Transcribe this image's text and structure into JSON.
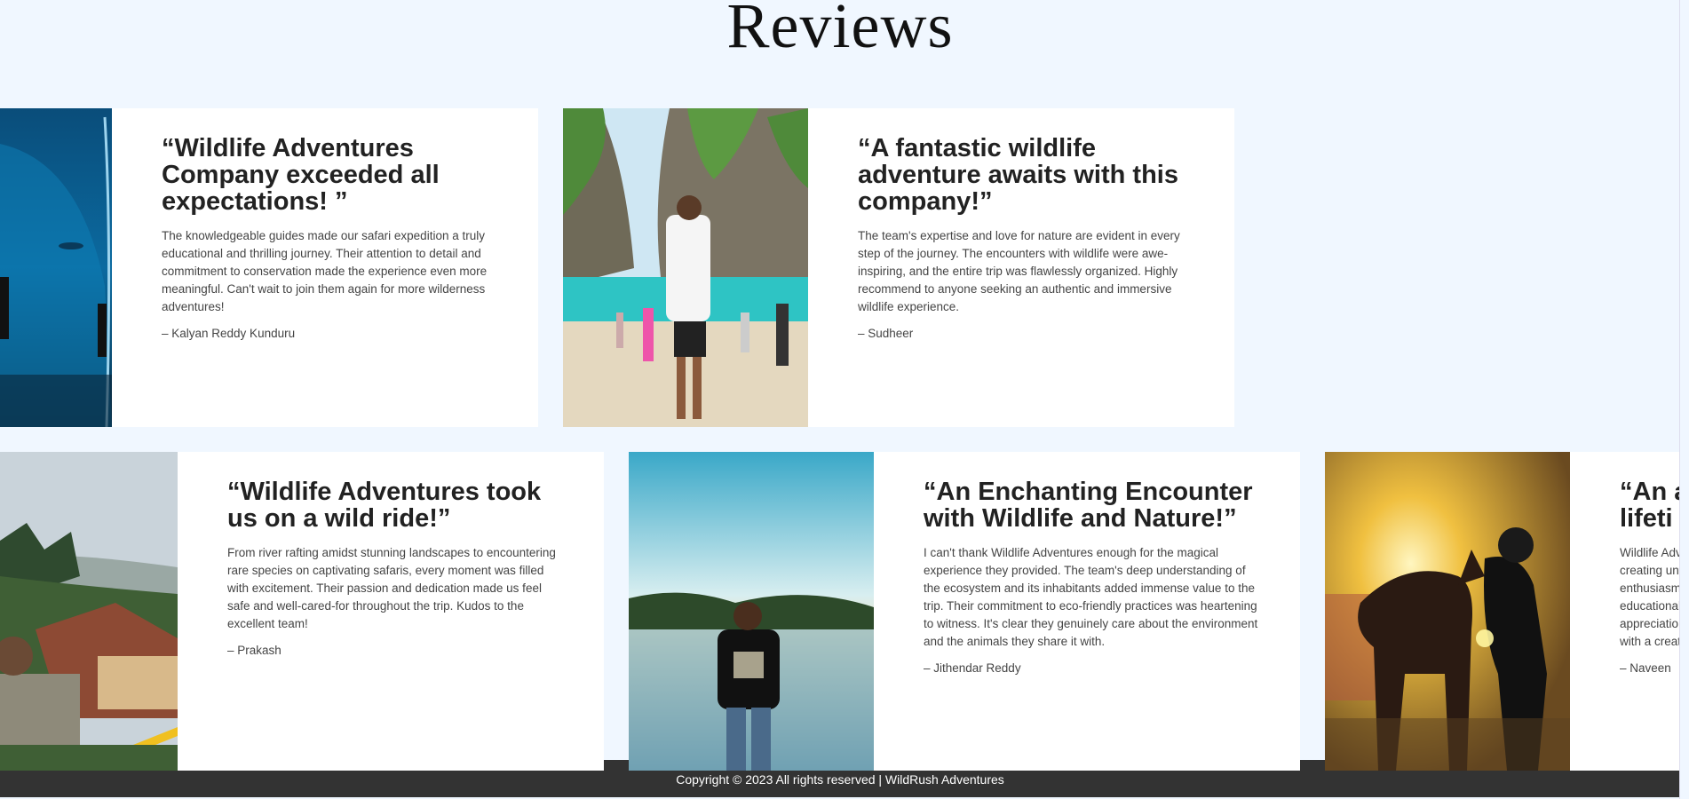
{
  "section": {
    "title": "Reviews"
  },
  "reviews": [
    {
      "quote": "“Wildlife Adventures Company exceeded all expectations! ”",
      "text": "The knowledgeable guides made our safari expedition a truly educational and thrilling journey. Their attention to detail and commitment to conservation made the experience even more meaningful. Can't wait to join them again for more wilderness adventures!",
      "author": "– Kalyan Reddy Kunduru",
      "photo": "aquarium-tunnel-photo"
    },
    {
      "quote": "“A fantastic wildlife adventure awaits with this company!”",
      "text": "The team's expertise and love for nature are evident in every step of the journey. The encounters with wildlife were awe-inspiring, and the entire trip was flawlessly organized. Highly recommend to anyone seeking an authentic and immersive wildlife experience.",
      "author": "– Sudheer",
      "photo": "beach-cliffs-photo"
    },
    {
      "quote": "“Wildlife Adventures took us on a wild ride!”",
      "text": "From river rafting amidst stunning landscapes to encountering rare species on captivating safaris, every moment was filled with excitement. Their passion and dedication made us feel safe and well-cared-for throughout the trip. Kudos to the excellent team!",
      "author": "– Prakash",
      "photo": "hill-village-photo"
    },
    {
      "quote": "“An Enchanting Encounter with Wildlife and Nature!”",
      "text": "I can't thank Wildlife Adventures enough for the magical experience they provided. The team's deep understanding of the ecosystem and its inhabitants added immense value to the trip. Their commitment to eco-friendly practices was heartening to witness. It's clear they genuinely care about the environment and the animals they share it with.",
      "author": "– Jithendar Reddy",
      "photo": "lake-sunset-photo"
    },
    {
      "quote": "“An a lifeti",
      "text": "Wildlife Adv creating unf enthusiasm educational appreciatio with a creati",
      "author": "– Naveen",
      "photo": "horse-sunset-photo"
    }
  ],
  "footer": {
    "text": "Copyright © 2023 All rights reserved | WildRush Adventures"
  }
}
